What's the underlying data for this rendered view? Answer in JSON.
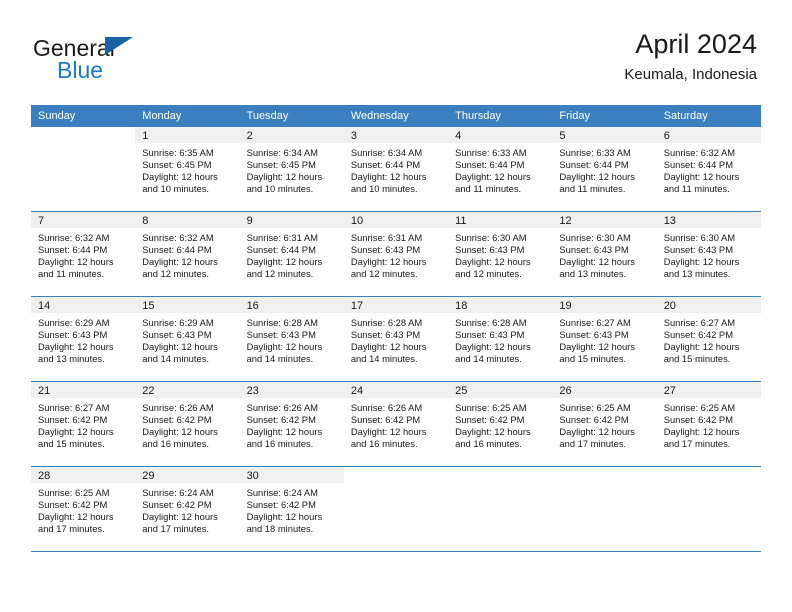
{
  "brand": {
    "line1": "General",
    "line2": "Blue",
    "triangle_color": "#1b62a5",
    "blue_color": "#1a7ac4"
  },
  "header": {
    "title": "April 2024",
    "location": "Keumala, Indonesia"
  },
  "theme": {
    "header_row_bg": "#3a80c1",
    "daynum_bg": "#f0f0f0",
    "grid_line": "#3a80c1",
    "text": "#1a1a1a"
  },
  "labels": {
    "sunrise_prefix": "Sunrise:",
    "sunset_prefix": "Sunset:",
    "daylight_prefix": "Daylight:"
  },
  "weekday_headers": [
    "Sunday",
    "Monday",
    "Tuesday",
    "Wednesday",
    "Thursday",
    "Friday",
    "Saturday"
  ],
  "weeks": [
    [
      {
        "day": ""
      },
      {
        "day": "1",
        "sunrise": "Sunrise: 6:35 AM",
        "sunset": "Sunset: 6:45 PM",
        "daylight_l1": "Daylight: 12 hours",
        "daylight_l2": "and 10 minutes."
      },
      {
        "day": "2",
        "sunrise": "Sunrise: 6:34 AM",
        "sunset": "Sunset: 6:45 PM",
        "daylight_l1": "Daylight: 12 hours",
        "daylight_l2": "and 10 minutes."
      },
      {
        "day": "3",
        "sunrise": "Sunrise: 6:34 AM",
        "sunset": "Sunset: 6:44 PM",
        "daylight_l1": "Daylight: 12 hours",
        "daylight_l2": "and 10 minutes."
      },
      {
        "day": "4",
        "sunrise": "Sunrise: 6:33 AM",
        "sunset": "Sunset: 6:44 PM",
        "daylight_l1": "Daylight: 12 hours",
        "daylight_l2": "and 11 minutes."
      },
      {
        "day": "5",
        "sunrise": "Sunrise: 6:33 AM",
        "sunset": "Sunset: 6:44 PM",
        "daylight_l1": "Daylight: 12 hours",
        "daylight_l2": "and 11 minutes."
      },
      {
        "day": "6",
        "sunrise": "Sunrise: 6:32 AM",
        "sunset": "Sunset: 6:44 PM",
        "daylight_l1": "Daylight: 12 hours",
        "daylight_l2": "and 11 minutes."
      }
    ],
    [
      {
        "day": "7",
        "sunrise": "Sunrise: 6:32 AM",
        "sunset": "Sunset: 6:44 PM",
        "daylight_l1": "Daylight: 12 hours",
        "daylight_l2": "and 11 minutes."
      },
      {
        "day": "8",
        "sunrise": "Sunrise: 6:32 AM",
        "sunset": "Sunset: 6:44 PM",
        "daylight_l1": "Daylight: 12 hours",
        "daylight_l2": "and 12 minutes."
      },
      {
        "day": "9",
        "sunrise": "Sunrise: 6:31 AM",
        "sunset": "Sunset: 6:44 PM",
        "daylight_l1": "Daylight: 12 hours",
        "daylight_l2": "and 12 minutes."
      },
      {
        "day": "10",
        "sunrise": "Sunrise: 6:31 AM",
        "sunset": "Sunset: 6:43 PM",
        "daylight_l1": "Daylight: 12 hours",
        "daylight_l2": "and 12 minutes."
      },
      {
        "day": "11",
        "sunrise": "Sunrise: 6:30 AM",
        "sunset": "Sunset: 6:43 PM",
        "daylight_l1": "Daylight: 12 hours",
        "daylight_l2": "and 12 minutes."
      },
      {
        "day": "12",
        "sunrise": "Sunrise: 6:30 AM",
        "sunset": "Sunset: 6:43 PM",
        "daylight_l1": "Daylight: 12 hours",
        "daylight_l2": "and 13 minutes."
      },
      {
        "day": "13",
        "sunrise": "Sunrise: 6:30 AM",
        "sunset": "Sunset: 6:43 PM",
        "daylight_l1": "Daylight: 12 hours",
        "daylight_l2": "and 13 minutes."
      }
    ],
    [
      {
        "day": "14",
        "sunrise": "Sunrise: 6:29 AM",
        "sunset": "Sunset: 6:43 PM",
        "daylight_l1": "Daylight: 12 hours",
        "daylight_l2": "and 13 minutes."
      },
      {
        "day": "15",
        "sunrise": "Sunrise: 6:29 AM",
        "sunset": "Sunset: 6:43 PM",
        "daylight_l1": "Daylight: 12 hours",
        "daylight_l2": "and 14 minutes."
      },
      {
        "day": "16",
        "sunrise": "Sunrise: 6:28 AM",
        "sunset": "Sunset: 6:43 PM",
        "daylight_l1": "Daylight: 12 hours",
        "daylight_l2": "and 14 minutes."
      },
      {
        "day": "17",
        "sunrise": "Sunrise: 6:28 AM",
        "sunset": "Sunset: 6:43 PM",
        "daylight_l1": "Daylight: 12 hours",
        "daylight_l2": "and 14 minutes."
      },
      {
        "day": "18",
        "sunrise": "Sunrise: 6:28 AM",
        "sunset": "Sunset: 6:43 PM",
        "daylight_l1": "Daylight: 12 hours",
        "daylight_l2": "and 14 minutes."
      },
      {
        "day": "19",
        "sunrise": "Sunrise: 6:27 AM",
        "sunset": "Sunset: 6:43 PM",
        "daylight_l1": "Daylight: 12 hours",
        "daylight_l2": "and 15 minutes."
      },
      {
        "day": "20",
        "sunrise": "Sunrise: 6:27 AM",
        "sunset": "Sunset: 6:42 PM",
        "daylight_l1": "Daylight: 12 hours",
        "daylight_l2": "and 15 minutes."
      }
    ],
    [
      {
        "day": "21",
        "sunrise": "Sunrise: 6:27 AM",
        "sunset": "Sunset: 6:42 PM",
        "daylight_l1": "Daylight: 12 hours",
        "daylight_l2": "and 15 minutes."
      },
      {
        "day": "22",
        "sunrise": "Sunrise: 6:26 AM",
        "sunset": "Sunset: 6:42 PM",
        "daylight_l1": "Daylight: 12 hours",
        "daylight_l2": "and 16 minutes."
      },
      {
        "day": "23",
        "sunrise": "Sunrise: 6:26 AM",
        "sunset": "Sunset: 6:42 PM",
        "daylight_l1": "Daylight: 12 hours",
        "daylight_l2": "and 16 minutes."
      },
      {
        "day": "24",
        "sunrise": "Sunrise: 6:26 AM",
        "sunset": "Sunset: 6:42 PM",
        "daylight_l1": "Daylight: 12 hours",
        "daylight_l2": "and 16 minutes."
      },
      {
        "day": "25",
        "sunrise": "Sunrise: 6:25 AM",
        "sunset": "Sunset: 6:42 PM",
        "daylight_l1": "Daylight: 12 hours",
        "daylight_l2": "and 16 minutes."
      },
      {
        "day": "26",
        "sunrise": "Sunrise: 6:25 AM",
        "sunset": "Sunset: 6:42 PM",
        "daylight_l1": "Daylight: 12 hours",
        "daylight_l2": "and 17 minutes."
      },
      {
        "day": "27",
        "sunrise": "Sunrise: 6:25 AM",
        "sunset": "Sunset: 6:42 PM",
        "daylight_l1": "Daylight: 12 hours",
        "daylight_l2": "and 17 minutes."
      }
    ],
    [
      {
        "day": "28",
        "sunrise": "Sunrise: 6:25 AM",
        "sunset": "Sunset: 6:42 PM",
        "daylight_l1": "Daylight: 12 hours",
        "daylight_l2": "and 17 minutes."
      },
      {
        "day": "29",
        "sunrise": "Sunrise: 6:24 AM",
        "sunset": "Sunset: 6:42 PM",
        "daylight_l1": "Daylight: 12 hours",
        "daylight_l2": "and 17 minutes."
      },
      {
        "day": "30",
        "sunrise": "Sunrise: 6:24 AM",
        "sunset": "Sunset: 6:42 PM",
        "daylight_l1": "Daylight: 12 hours",
        "daylight_l2": "and 18 minutes."
      },
      {
        "day": ""
      },
      {
        "day": ""
      },
      {
        "day": ""
      },
      {
        "day": ""
      }
    ]
  ]
}
